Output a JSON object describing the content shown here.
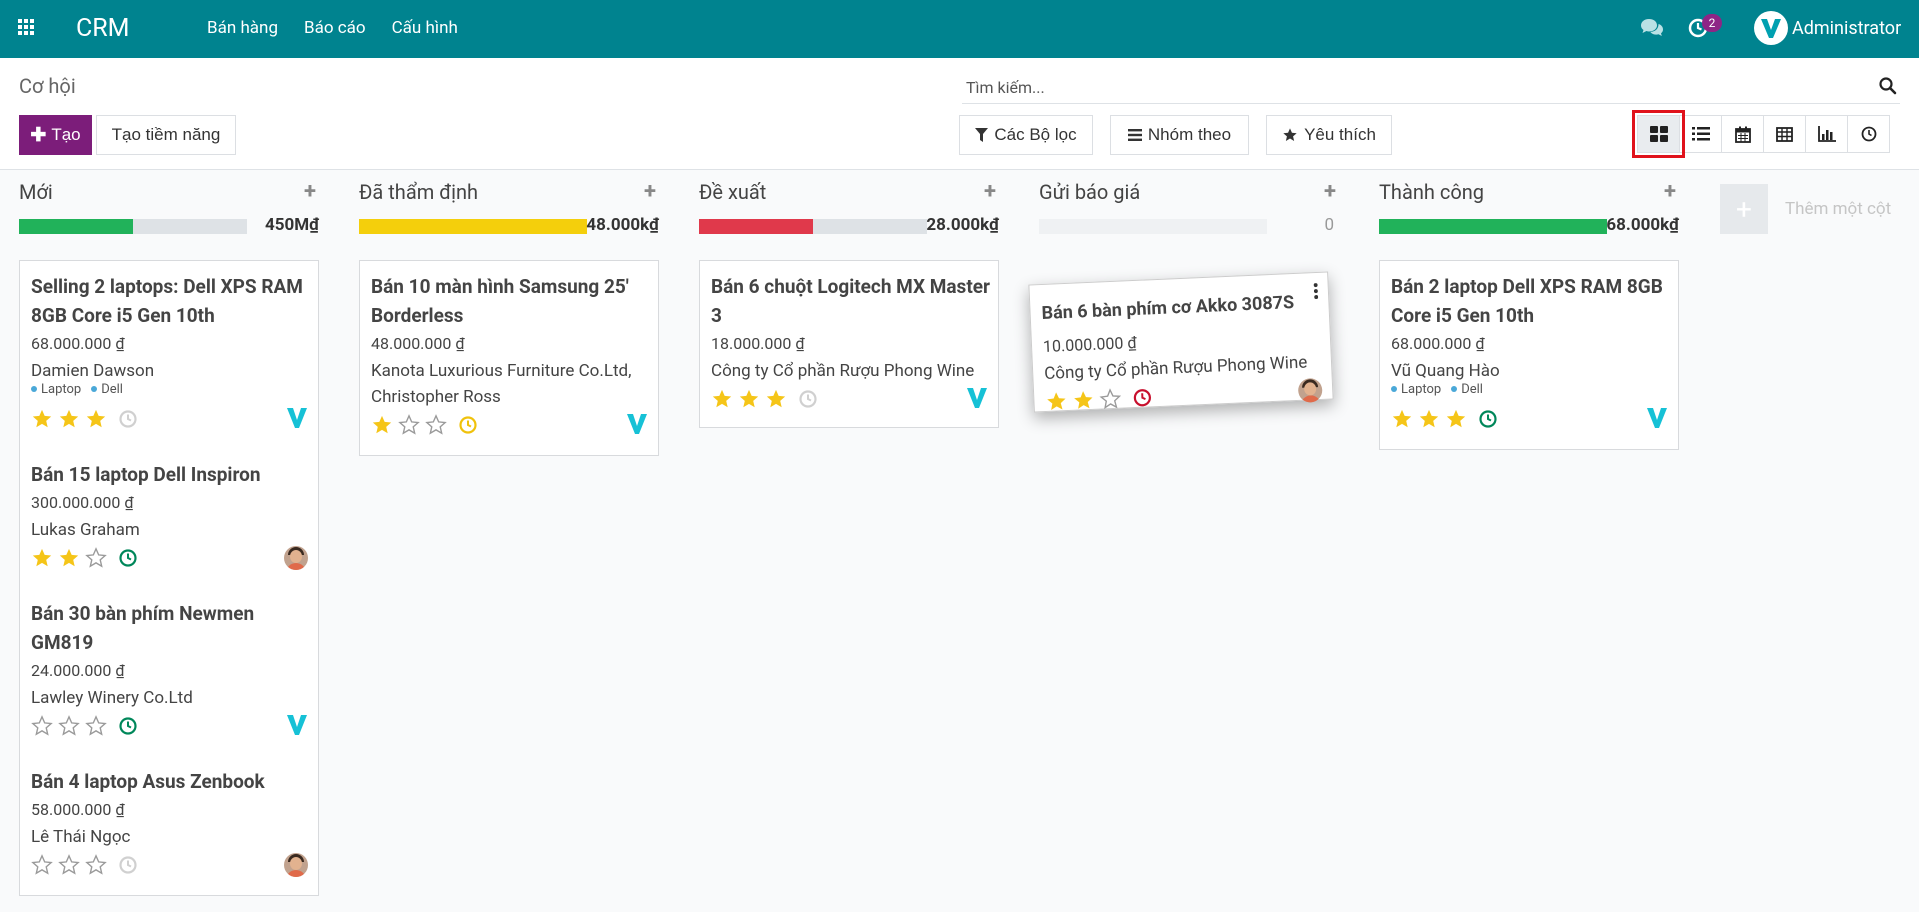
{
  "navbar": {
    "brand": "CRM",
    "menu": [
      "Bán hàng",
      "Báo cáo",
      "Cấu hình"
    ],
    "activity_count": "2",
    "user_name": "Administrator"
  },
  "control": {
    "breadcrumb": "Cơ hội",
    "create_label": "Tạo",
    "lead_label": "Tạo tiềm năng",
    "search_placeholder": "Tìm kiếm...",
    "filters_label": "Các Bộ lọc",
    "groupby_label": "Nhóm theo",
    "favorites_label": "Yêu thích",
    "views": [
      "kanban-icon",
      "list-icon",
      "calendar-icon",
      "pivot-icon",
      "graph-icon",
      "activity-view-icon"
    ]
  },
  "colors": {
    "navbar": "#00838f",
    "primary": "#7c1d7a",
    "green": "#21b25a",
    "yellow": "#f4cf0c",
    "red": "#e0394b",
    "star": "#f5c518"
  },
  "columns": [
    {
      "title": "Mới",
      "total": "450M₫",
      "progress": [
        {
          "color": "#21b25a",
          "pct": 50
        },
        {
          "color": "#dee2e6",
          "pct": 50
        }
      ],
      "cards": [
        {
          "title": "Selling 2 laptops: Dell XPS RAM 8GB Core i5 Gen 10th",
          "amount": "68.000.000 ₫",
          "customer": "Damien Dawson",
          "tags": [
            "Laptop",
            "Dell"
          ],
          "stars": 3,
          "activity": "gray",
          "assignee": "v-logo"
        },
        {
          "title": "Bán 15 laptop Dell Inspiron",
          "amount": "300.000.000 ₫",
          "customer": "Lukas Graham",
          "tags": [],
          "stars": 2,
          "activity": "green",
          "assignee": "avatar"
        },
        {
          "title": "Bán 30 bàn phím Newmen GM819",
          "amount": "24.000.000 ₫",
          "customer": "Lawley Winery Co.Ltd",
          "tags": [],
          "stars": 0,
          "activity": "green",
          "assignee": "v-logo"
        },
        {
          "title": "Bán 4 laptop Asus Zenbook",
          "amount": "58.000.000 ₫",
          "customer": "Lê Thái Ngọc",
          "tags": [],
          "stars": 0,
          "activity": "gray",
          "assignee": "avatar"
        }
      ]
    },
    {
      "title": "Đã thẩm định",
      "total": "48.000k₫",
      "progress": [
        {
          "color": "#f4cf0c",
          "pct": 100
        }
      ],
      "cards": [
        {
          "title": "Bán 10 màn hình Samsung 25' Borderless",
          "amount": "48.000.000 ₫",
          "customer": "Kanota Luxurious Furniture Co.Ltd, Christopher Ross",
          "tags": [],
          "stars": 1,
          "activity": "yellow",
          "assignee": "v-logo"
        }
      ]
    },
    {
      "title": "Đề xuất",
      "total": "28.000k₫",
      "progress": [
        {
          "color": "#e0394b",
          "pct": 50
        },
        {
          "color": "#dee2e6",
          "pct": 50
        }
      ],
      "cards": [
        {
          "title": "Bán 6 chuột Logitech MX Master 3",
          "amount": "18.000.000 ₫",
          "customer": "Công ty Cổ phần Rượu Phong Wine",
          "tags": [],
          "stars": 3,
          "activity": "gray",
          "assignee": "v-logo"
        }
      ]
    },
    {
      "title": "Gửi báo giá",
      "total": "0",
      "progress": [],
      "cards": [
        {
          "title": "Bán 6 bàn phím cơ Akko 3087S",
          "amount": "10.000.000 ₫",
          "customer": "Công ty Cổ phần Rượu Phong Wine",
          "tags": [],
          "stars": 2,
          "activity": "red",
          "assignee": "avatar",
          "dragging": true
        }
      ]
    },
    {
      "title": "Thành công",
      "total": "68.000k₫",
      "progress": [
        {
          "color": "#21b25a",
          "pct": 100
        }
      ],
      "cards": [
        {
          "title": "Bán 2 laptop Dell XPS RAM 8GB Core i5 Gen 10th",
          "amount": "68.000.000 ₫",
          "customer": "Vũ Quang Hào",
          "tags": [
            "Laptop",
            "Dell"
          ],
          "stars": 3,
          "activity": "green",
          "assignee": "v-logo"
        }
      ]
    }
  ],
  "add_column_label": "Thêm một cột"
}
